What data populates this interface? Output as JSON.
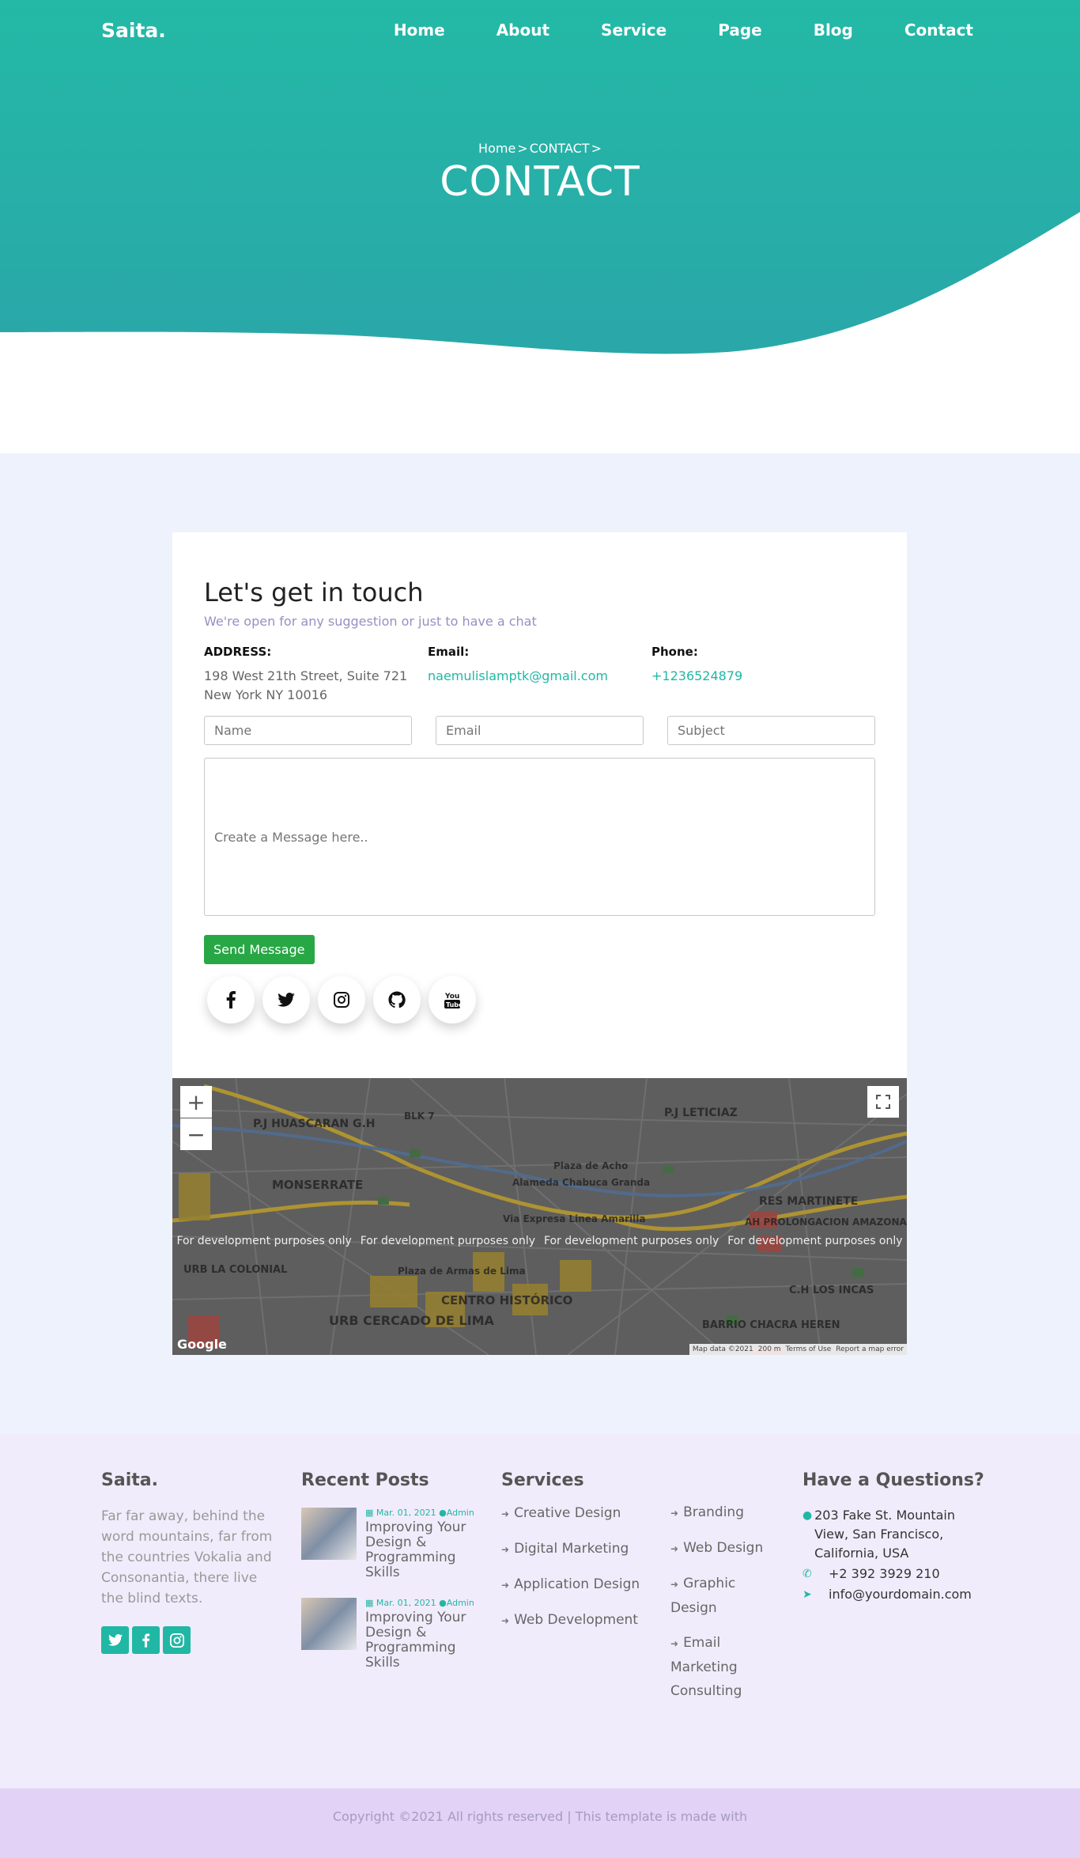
{
  "nav": {
    "logo": "Saita.",
    "links": [
      "Home",
      "About",
      "Service",
      "Page",
      "Blog",
      "Contact"
    ]
  },
  "hero": {
    "breadcrumb": [
      "Home",
      ">",
      "CONTACT",
      ">"
    ],
    "title": "CONTACT"
  },
  "contact": {
    "heading": "Let's get in touch",
    "subtitle": "We're open for any suggestion or just to have a chat",
    "address_label": "ADDRESS:",
    "address_line1": "198 West 21th Street, Suite 721",
    "address_line2": "New York NY 10016",
    "email_label": "Email:",
    "email_value": "naemulislamptk@gmail.com",
    "phone_label": "Phone:",
    "phone_value": "+1236524879",
    "name_placeholder": "Name",
    "email_placeholder": "Email",
    "subject_placeholder": "Subject",
    "message_placeholder": "Create a Message here..",
    "send_label": "Send Message",
    "socials": [
      "facebook-icon",
      "twitter-icon",
      "instagram-icon",
      "github-icon",
      "youtube-icon"
    ]
  },
  "map": {
    "zoom_in": "+",
    "zoom_out": "−",
    "watermark": "For development purposes only",
    "labels": [
      "P.J HUASCARAN G.H",
      "BLK 7",
      "P.J LETICIAZ",
      "MONSERRATE",
      "Alameda Chabuca Granda",
      "Plaza de Acho",
      "Via Expresa Linea Amarilla",
      "RES MARTINETE",
      "AH PROLONGACION AMAZONAS",
      "CENTRO HISTÓRICO",
      "URB CERCADO DE LIMA",
      "Plaza de Armas de Lima",
      "BARRIO CHACRA HEREN",
      "C.H LOS INCAS",
      "URB LA COLONIAL"
    ],
    "footer": [
      "Map data ©2021",
      "200 m",
      "Terms of Use",
      "Report a map error"
    ],
    "google": "Google"
  },
  "footer": {
    "about_title": "Saita.",
    "about_text": "Far far away, behind the word mountains, far from the countries Vokalia and Consonantia, there live the blind texts.",
    "socials": [
      "twitter-icon",
      "facebook-icon",
      "instagram-icon"
    ],
    "posts_title": "Recent Posts",
    "posts": [
      {
        "date": "Mar. 01, 2021",
        "author": "Admin",
        "title": "Improving Your Design & Programming Skills"
      },
      {
        "date": "Mar. 01, 2021",
        "author": "Admin",
        "title": "Improving Your Design & Programming Skills"
      }
    ],
    "services_title": "Services",
    "services_col1": [
      "Creative Design",
      "Digital Marketing",
      "Application Design",
      "Web Development"
    ],
    "services_col2": [
      "Branding",
      "Web Design",
      "Graphic Design",
      "Email Marketing Consulting"
    ],
    "questions_title": "Have a Questions?",
    "address": "203 Fake St. Mountain View, San Francisco, California, USA",
    "phone": "+2 392 3929 210",
    "email": "info@yourdomain.com",
    "copyright": "Copyright ©2021 All rights reserved | This template is made with"
  },
  "colors": {
    "accent": "#21b7a5",
    "hero_gradient_top": "#23b9a6",
    "hero_gradient_bottom": "#2aa7a9",
    "send_button": "#28a745"
  }
}
